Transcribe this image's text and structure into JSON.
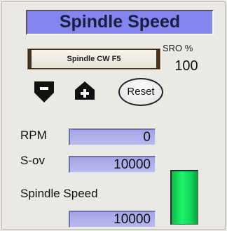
{
  "header": {
    "title": "Spindle Speed"
  },
  "controls": {
    "spindle_button_label": "Spindle CW F5",
    "reset_label": "Reset",
    "down_icon": "down-arrow-minus-icon",
    "up_icon": "up-arrow-plus-icon"
  },
  "sro": {
    "label": "SRO %",
    "value": "100"
  },
  "fields": {
    "rpm_label": "RPM",
    "rpm_value": "0",
    "sov_label": "S-ov",
    "sov_value": "10000",
    "spindle_speed_label": "Spindle Speed",
    "spindle_speed_value": "10000"
  },
  "indicator": {
    "state": "on",
    "color": "#1ef36a"
  },
  "colors": {
    "header_bg": "#8585f0",
    "dro_bg": "#b0b0ec",
    "panel_bg": "#ebe9e3"
  }
}
